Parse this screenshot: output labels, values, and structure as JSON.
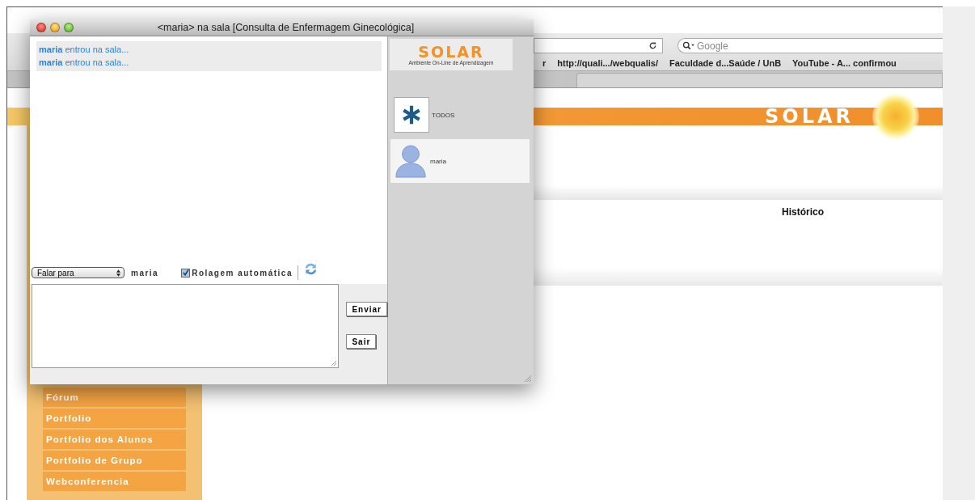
{
  "browser": {
    "search": {
      "placeholder": "Google"
    },
    "bookmarks": [
      "r",
      "http://quali.../webqualis/",
      "Faculdade d...Saúde / UnB",
      "YouTube - A... confirmou"
    ]
  },
  "page": {
    "banner_logo": "SOLAR",
    "heading": "Histórico",
    "menu": [
      "Fórum",
      "Portfolio",
      "Portfolio dos Alunos",
      "Portfolio de Grupo",
      "Webconferencia"
    ]
  },
  "chat_window": {
    "title": "<maria> na sala [Consulta de Enfermagem Ginecológica]",
    "messages": [
      "**maria** entrou na sala...",
      "**maria** entrou na sala..."
    ],
    "logo": {
      "name": "SOLAR",
      "tagline": "Ambiente On-Line de Aprendizagem"
    },
    "users": [
      {
        "name": "TODOS",
        "kind": "everyone",
        "selected": false
      },
      {
        "name": "maria",
        "kind": "person",
        "selected": true
      }
    ],
    "recipient_select": "Falar para",
    "recipient": "maria",
    "auto_scroll": {
      "label": "Rolagem automática",
      "checked": true
    },
    "buttons": [
      "Enviar",
      "Sair"
    ]
  }
}
